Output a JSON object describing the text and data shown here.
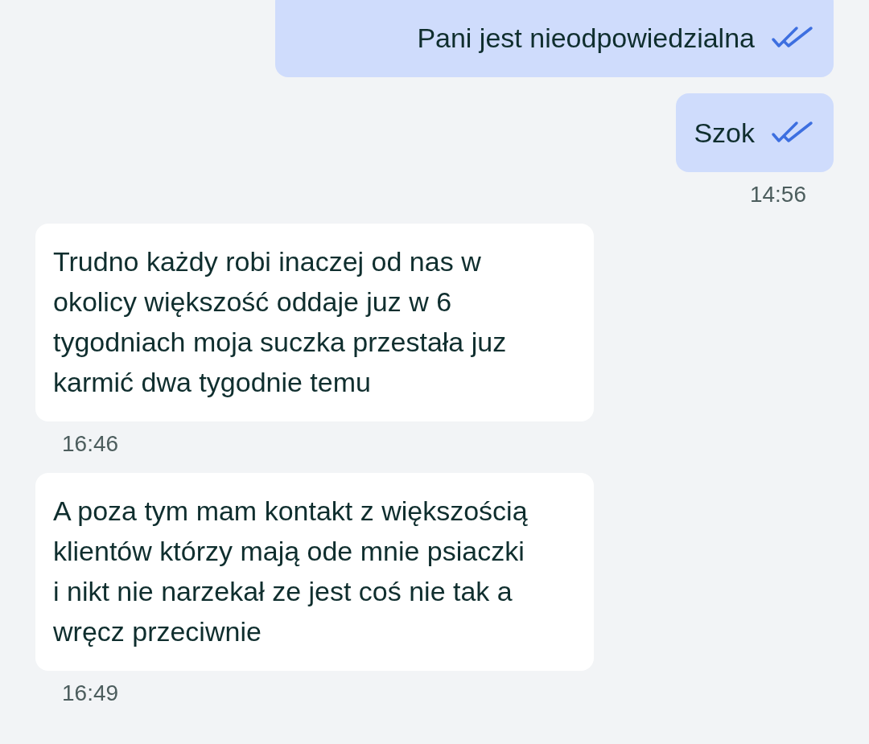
{
  "messages": [
    {
      "kind": "sent",
      "text": "Pani jest nieodpowiedzialna",
      "read": true
    },
    {
      "kind": "sent",
      "text": "Szok",
      "read": true,
      "time": "14:56"
    },
    {
      "kind": "received",
      "text": "Trudno każdy robi inaczej od nas w okolicy większość oddaje juz w 6 tygodniach moja suczka przestała juz karmić dwa tygodnie temu",
      "time": "16:46"
    },
    {
      "kind": "received",
      "text": "A poza tym mam kontakt z większością klientów którzy mają ode mnie psiaczki i nikt nie narzekał ze jest coś nie tak a wręcz przeciwnie",
      "time": "16:49"
    }
  ]
}
